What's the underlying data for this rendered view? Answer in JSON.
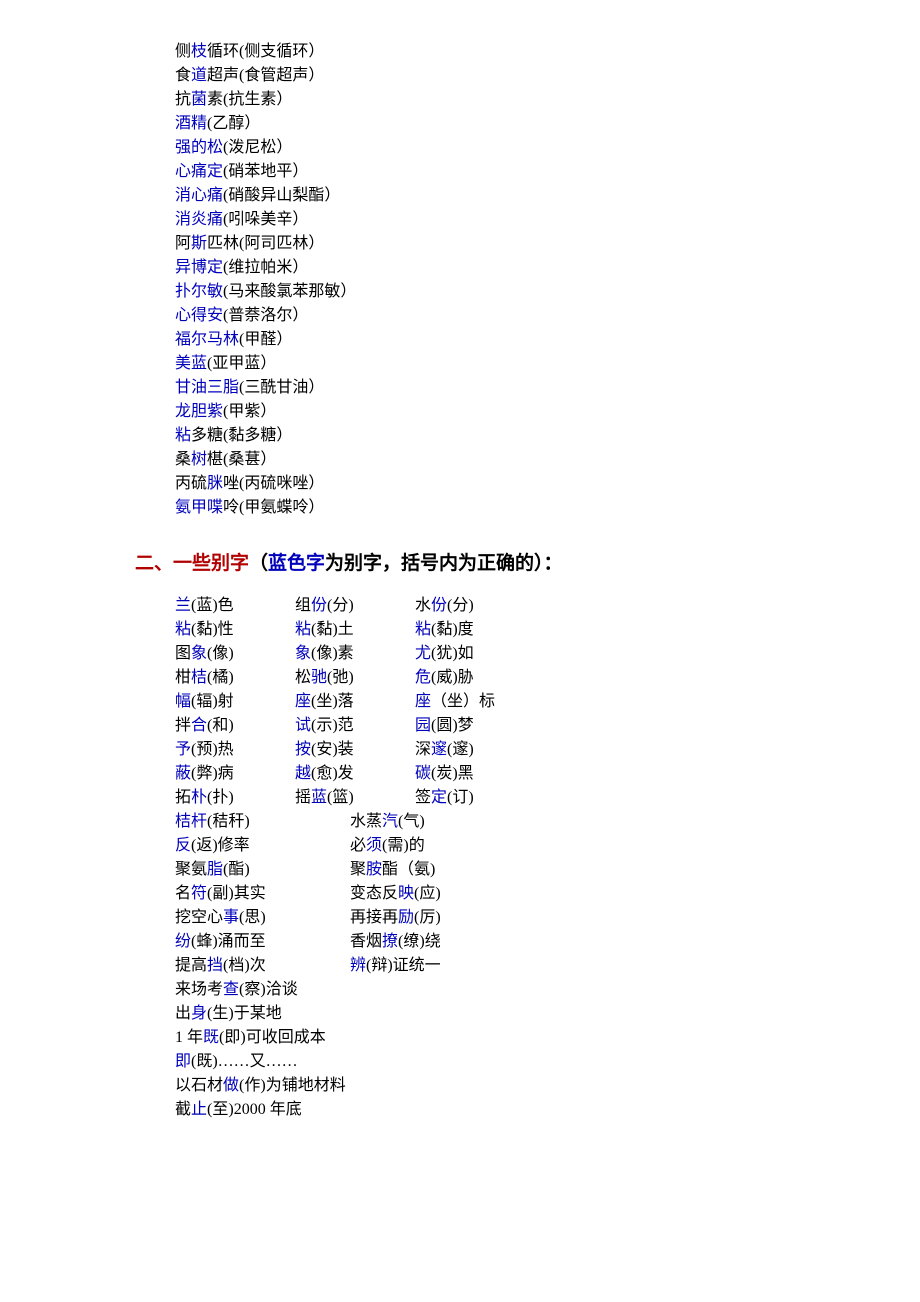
{
  "section1": [
    [
      {
        "t": "侧"
      },
      {
        "t": "枝",
        "b": 1
      },
      {
        "t": "循环(侧支循环）"
      }
    ],
    [
      {
        "t": "食"
      },
      {
        "t": "道",
        "b": 1
      },
      {
        "t": "超声(食管超声）"
      }
    ],
    [
      {
        "t": "抗"
      },
      {
        "t": "菌",
        "b": 1
      },
      {
        "t": "素(抗生素）"
      }
    ],
    [
      {
        "t": "酒精",
        "b": 1
      },
      {
        "t": "(乙醇）"
      }
    ],
    [
      {
        "t": "强的松",
        "b": 1
      },
      {
        "t": "(泼尼松）"
      }
    ],
    [
      {
        "t": "心痛定",
        "b": 1
      },
      {
        "t": "(硝苯地平）"
      }
    ],
    [
      {
        "t": "消心痛",
        "b": 1
      },
      {
        "t": "(硝酸异山梨酯）"
      }
    ],
    [
      {
        "t": "消炎痛",
        "b": 1
      },
      {
        "t": "(吲哚美辛）"
      }
    ],
    [
      {
        "t": "阿"
      },
      {
        "t": "斯",
        "b": 1
      },
      {
        "t": "匹林(阿司匹林）"
      }
    ],
    [
      {
        "t": "异博定",
        "b": 1
      },
      {
        "t": "(维拉帕米）"
      }
    ],
    [
      {
        "t": "扑尔敏",
        "b": 1
      },
      {
        "t": "(马来酸氯苯那敏）"
      }
    ],
    [
      {
        "t": "心得安",
        "b": 1
      },
      {
        "t": "(普萘洛尔）"
      }
    ],
    [
      {
        "t": "福尔马林",
        "b": 1
      },
      {
        "t": "(甲醛）"
      }
    ],
    [
      {
        "t": "美蓝",
        "b": 1
      },
      {
        "t": "(亚甲蓝）"
      }
    ],
    [
      {
        "t": "甘油三脂",
        "b": 1
      },
      {
        "t": "(三酰甘油）"
      }
    ],
    [
      {
        "t": "龙胆紫",
        "b": 1
      },
      {
        "t": "(甲紫）"
      }
    ],
    [
      {
        "t": "粘",
        "b": 1
      },
      {
        "t": "多糖(黏多糖）"
      }
    ],
    [
      {
        "t": "桑"
      },
      {
        "t": "树",
        "b": 1
      },
      {
        "t": "椹(桑葚）"
      }
    ],
    [
      {
        "t": "丙硫"
      },
      {
        "t": "脒",
        "b": 1
      },
      {
        "t": "唑(丙硫咪唑）"
      }
    ],
    [
      {
        "t": "氨甲喋",
        "b": 1
      },
      {
        "t": "呤(甲氨蝶呤）"
      }
    ]
  ],
  "heading": {
    "part1": "二、一些别字",
    "part2": "（",
    "part3": "蓝色字",
    "part4": "为别字，括号内为正确的）："
  },
  "section2_three": [
    [
      [
        {
          "t": "兰",
          "b": 1
        },
        {
          "t": "(蓝)色"
        }
      ],
      [
        {
          "t": "组"
        },
        {
          "t": "份",
          "b": 1
        },
        {
          "t": "(分)"
        }
      ],
      [
        {
          "t": "水"
        },
        {
          "t": "份",
          "b": 1
        },
        {
          "t": "(分)"
        }
      ]
    ],
    [
      [
        {
          "t": "粘",
          "b": 1
        },
        {
          "t": "(黏)性"
        }
      ],
      [
        {
          "t": "粘",
          "b": 1
        },
        {
          "t": "(黏)土"
        }
      ],
      [
        {
          "t": "粘",
          "b": 1
        },
        {
          "t": "(黏)度"
        }
      ]
    ],
    [
      [
        {
          "t": "图"
        },
        {
          "t": "象",
          "b": 1
        },
        {
          "t": "(像)"
        }
      ],
      [
        {
          "t": "象",
          "b": 1
        },
        {
          "t": "(像)素"
        }
      ],
      [
        {
          "t": "尤",
          "b": 1
        },
        {
          "t": "(犹)如"
        }
      ]
    ],
    [
      [
        {
          "t": "柑"
        },
        {
          "t": "桔",
          "b": 1
        },
        {
          "t": "(橘)"
        }
      ],
      [
        {
          "t": "松"
        },
        {
          "t": "驰",
          "b": 1
        },
        {
          "t": "(弛)"
        }
      ],
      [
        {
          "t": "危",
          "b": 1
        },
        {
          "t": "(威)胁"
        }
      ]
    ],
    [
      [
        {
          "t": "幅",
          "b": 1
        },
        {
          "t": "(辐)射"
        }
      ],
      [
        {
          "t": "座",
          "b": 1
        },
        {
          "t": "(坐)落"
        }
      ],
      [
        {
          "t": "座",
          "b": 1
        },
        {
          "t": "（坐）标"
        }
      ]
    ],
    [
      [
        {
          "t": "拌"
        },
        {
          "t": "合",
          "b": 1
        },
        {
          "t": "(和)"
        }
      ],
      [
        {
          "t": "试",
          "b": 1
        },
        {
          "t": "(示)范"
        }
      ],
      [
        {
          "t": "园",
          "b": 1
        },
        {
          "t": "(圆)梦"
        }
      ]
    ],
    [
      [
        {
          "t": "予",
          "b": 1
        },
        {
          "t": "(预)热"
        }
      ],
      [
        {
          "t": "按",
          "b": 1
        },
        {
          "t": "(安)装"
        }
      ],
      [
        {
          "t": "深"
        },
        {
          "t": "邃",
          "b": 1
        },
        {
          "t": "(邃)"
        }
      ]
    ],
    [
      [
        {
          "t": "蔽",
          "b": 1
        },
        {
          "t": "(弊)病"
        }
      ],
      [
        {
          "t": "越",
          "b": 1
        },
        {
          "t": "(愈)发"
        }
      ],
      [
        {
          "t": "碳",
          "b": 1
        },
        {
          "t": "(炭)黑"
        }
      ]
    ],
    [
      [
        {
          "t": "拓"
        },
        {
          "t": "朴",
          "b": 1
        },
        {
          "t": "(扑)"
        }
      ],
      [
        {
          "t": "摇"
        },
        {
          "t": "蓝",
          "b": 1
        },
        {
          "t": "(篮)"
        }
      ],
      [
        {
          "t": "签"
        },
        {
          "t": "定",
          "b": 1
        },
        {
          "t": "(订)"
        }
      ]
    ]
  ],
  "section2_two": [
    [
      [
        {
          "t": "桔杆",
          "b": 1
        },
        {
          "t": "(秸秆)"
        }
      ],
      [
        {
          "t": "水蒸"
        },
        {
          "t": "汽",
          "b": 1
        },
        {
          "t": "(气)"
        }
      ]
    ],
    [
      [
        {
          "t": "反",
          "b": 1
        },
        {
          "t": "(返)修率"
        }
      ],
      [
        {
          "t": "必"
        },
        {
          "t": "须",
          "b": 1
        },
        {
          "t": "(需)的"
        }
      ]
    ],
    [
      [
        {
          "t": "聚氨"
        },
        {
          "t": "脂",
          "b": 1
        },
        {
          "t": "(酯)"
        }
      ],
      [
        {
          "t": "聚"
        },
        {
          "t": "胺",
          "b": 1
        },
        {
          "t": "酯（氨)"
        }
      ]
    ],
    [
      [
        {
          "t": "名"
        },
        {
          "t": "符",
          "b": 1
        },
        {
          "t": "(副)其实"
        }
      ],
      [
        {
          "t": "变态反"
        },
        {
          "t": "映",
          "b": 1
        },
        {
          "t": "(应)"
        }
      ]
    ],
    [
      [
        {
          "t": "挖空心"
        },
        {
          "t": "事",
          "b": 1
        },
        {
          "t": "(思)"
        }
      ],
      [
        {
          "t": "再接再"
        },
        {
          "t": "励",
          "b": 1
        },
        {
          "t": "(厉)"
        }
      ]
    ],
    [
      [
        {
          "t": "纷",
          "b": 1
        },
        {
          "t": "(蜂)涌而至"
        }
      ],
      [
        {
          "t": "香烟"
        },
        {
          "t": "撩",
          "b": 1
        },
        {
          "t": "(缭)绕"
        }
      ]
    ],
    [
      [
        {
          "t": "提高"
        },
        {
          "t": "挡",
          "b": 1
        },
        {
          "t": "(档)次"
        }
      ],
      [
        {
          "t": "辨",
          "b": 1
        },
        {
          "t": "(辩)证统一"
        }
      ]
    ]
  ],
  "section2_one": [
    [
      {
        "t": "来场考"
      },
      {
        "t": "查",
        "b": 1
      },
      {
        "t": "(察)洽谈"
      }
    ],
    [
      {
        "t": "出"
      },
      {
        "t": "身",
        "b": 1
      },
      {
        "t": "(生)于某地"
      }
    ],
    [
      {
        "t": "1 年"
      },
      {
        "t": "既",
        "b": 1
      },
      {
        "t": "(即)可收回成本"
      }
    ],
    [
      {
        "t": "即",
        "b": 1
      },
      {
        "t": "(既)……又……"
      }
    ],
    [
      {
        "t": "以石材"
      },
      {
        "t": "做",
        "b": 1
      },
      {
        "t": "(作)为铺地材料"
      }
    ],
    [
      {
        "t": "截"
      },
      {
        "t": "止",
        "b": 1
      },
      {
        "t": "(至)2000 年底"
      }
    ]
  ]
}
